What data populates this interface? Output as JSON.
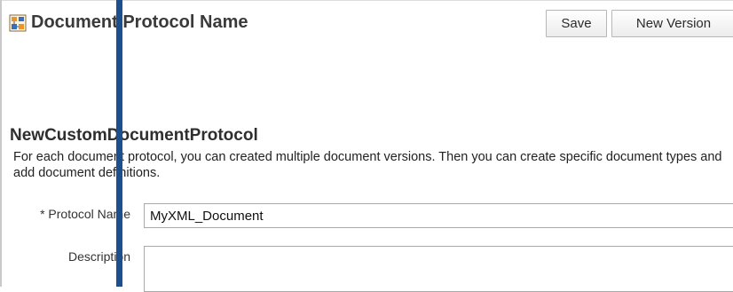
{
  "header": {
    "title": "Document Protocol Name",
    "icon": "document-protocol-icon"
  },
  "toolbar": {
    "save_label": "Save",
    "new_version_label": "New Version"
  },
  "section": {
    "title": "NewCustomDocumentProtocol",
    "description": "For each document protocol, you can created multiple document versions. Then you can create specific document types and add document definitions."
  },
  "form": {
    "protocol_name": {
      "required_marker": "*",
      "label": "Protocol Name",
      "value": "MyXML_Document"
    },
    "description": {
      "label": "Description",
      "value": ""
    }
  },
  "colors": {
    "overlay_bar": "#1d4f8f",
    "icon_orange": "#e8952a",
    "icon_blue": "#3a6fb5"
  }
}
